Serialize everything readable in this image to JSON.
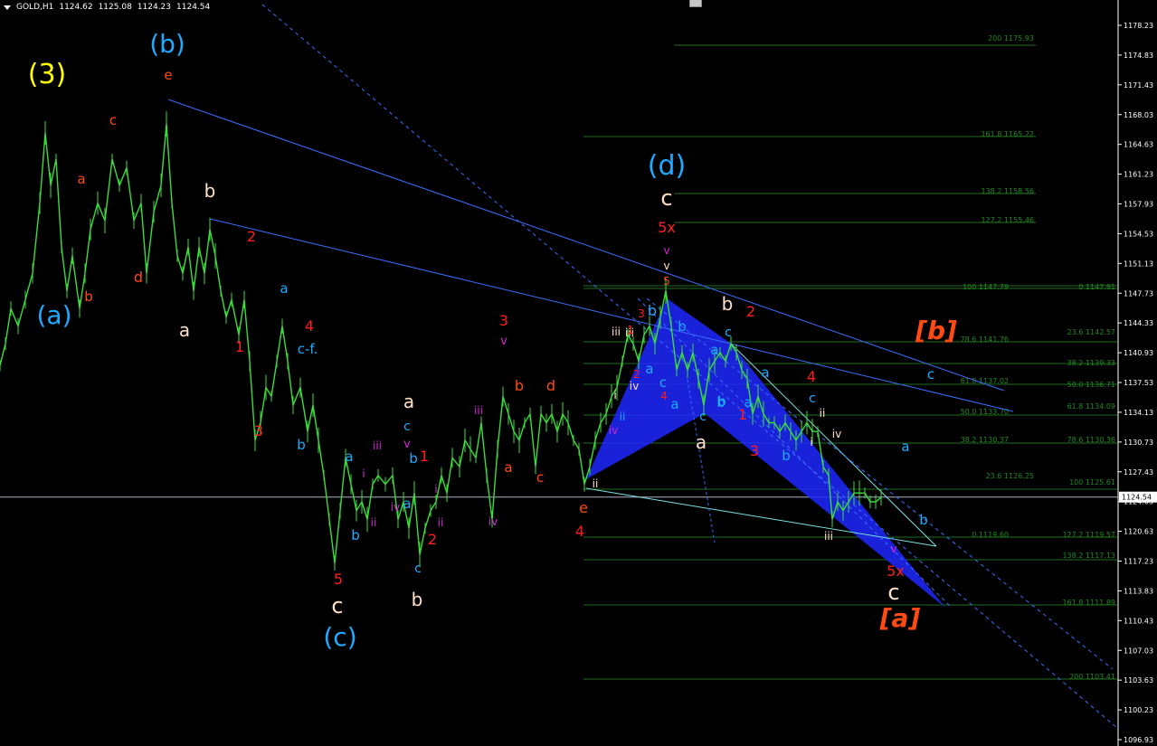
{
  "header": {
    "symbol": "GOLD,H1",
    "open": "1124.62",
    "high": "1125.08",
    "low": "1124.23",
    "close": "1124.54"
  },
  "chart_data": {
    "type": "candlestick",
    "symbol": "GOLD,H1",
    "ylim": [
      1096.93,
      1178.23
    ],
    "y_ticks": [
      "1178.23",
      "1174.83",
      "1171.43",
      "1168.03",
      "1164.63",
      "1161.23",
      "1157.93",
      "1154.53",
      "1151.13",
      "1147.73",
      "1144.33",
      "1140.93",
      "1137.53",
      "1134.13",
      "1130.73",
      "1127.43",
      "1124.03",
      "1120.63",
      "1117.23",
      "1113.83",
      "1110.43",
      "1107.03",
      "1103.63",
      "1100.23",
      "1096.93"
    ],
    "current_price": "1124.54",
    "price_series": [
      [
        0,
        1139.5
      ],
      [
        6,
        1142
      ],
      [
        12,
        1146
      ],
      [
        20,
        1144
      ],
      [
        28,
        1147
      ],
      [
        36,
        1150
      ],
      [
        44,
        1158
      ],
      [
        50,
        1166
      ],
      [
        56,
        1160
      ],
      [
        62,
        1163
      ],
      [
        68,
        1153
      ],
      [
        74,
        1148
      ],
      [
        80,
        1152
      ],
      [
        88,
        1146
      ],
      [
        94,
        1150
      ],
      [
        100,
        1155
      ],
      [
        108,
        1158
      ],
      [
        116,
        1156
      ],
      [
        124,
        1163
      ],
      [
        132,
        1160
      ],
      [
        140,
        1162
      ],
      [
        148,
        1156
      ],
      [
        156,
        1158
      ],
      [
        162,
        1150
      ],
      [
        170,
        1157
      ],
      [
        178,
        1160
      ],
      [
        184,
        1167
      ],
      [
        190,
        1158
      ],
      [
        196,
        1152
      ],
      [
        202,
        1150
      ],
      [
        208,
        1153
      ],
      [
        214,
        1148
      ],
      [
        220,
        1153
      ],
      [
        226,
        1150
      ],
      [
        232,
        1155
      ],
      [
        238,
        1152
      ],
      [
        244,
        1148
      ],
      [
        250,
        1145
      ],
      [
        256,
        1147
      ],
      [
        264,
        1143
      ],
      [
        270,
        1147
      ],
      [
        276,
        1140
      ],
      [
        282,
        1131
      ],
      [
        288,
        1133
      ],
      [
        294,
        1137
      ],
      [
        300,
        1136
      ],
      [
        306,
        1140
      ],
      [
        312,
        1144
      ],
      [
        318,
        1140
      ],
      [
        324,
        1135
      ],
      [
        332,
        1137
      ],
      [
        340,
        1132
      ],
      [
        346,
        1135
      ],
      [
        352,
        1131
      ],
      [
        358,
        1127
      ],
      [
        364,
        1122
      ],
      [
        370,
        1117
      ],
      [
        376,
        1123
      ],
      [
        382,
        1129
      ],
      [
        388,
        1126
      ],
      [
        394,
        1123
      ],
      [
        400,
        1124
      ],
      [
        406,
        1122
      ],
      [
        412,
        1126
      ],
      [
        418,
        1127
      ],
      [
        426,
        1126
      ],
      [
        434,
        1127
      ],
      [
        440,
        1122
      ],
      [
        446,
        1124
      ],
      [
        452,
        1121
      ],
      [
        458,
        1125
      ],
      [
        464,
        1118
      ],
      [
        470,
        1121
      ],
      [
        476,
        1123
      ],
      [
        482,
        1124
      ],
      [
        488,
        1127
      ],
      [
        494,
        1125
      ],
      [
        500,
        1129
      ],
      [
        508,
        1128
      ],
      [
        514,
        1131
      ],
      [
        520,
        1130
      ],
      [
        526,
        1129
      ],
      [
        532,
        1133
      ],
      [
        538,
        1127
      ],
      [
        544,
        1122
      ],
      [
        550,
        1130
      ],
      [
        556,
        1136
      ],
      [
        562,
        1134
      ],
      [
        568,
        1132
      ],
      [
        574,
        1131
      ],
      [
        580,
        1133
      ],
      [
        586,
        1134
      ],
      [
        592,
        1128
      ],
      [
        598,
        1134
      ],
      [
        604,
        1133
      ],
      [
        610,
        1134
      ],
      [
        616,
        1132
      ],
      [
        622,
        1134
      ],
      [
        628,
        1133
      ],
      [
        634,
        1131
      ],
      [
        640,
        1130
      ],
      [
        646,
        1126
      ],
      [
        652,
        1128
      ],
      [
        658,
        1131
      ],
      [
        664,
        1133
      ],
      [
        670,
        1134
      ],
      [
        676,
        1136
      ],
      [
        682,
        1137
      ],
      [
        688,
        1140
      ],
      [
        694,
        1143
      ],
      [
        700,
        1142
      ],
      [
        706,
        1140
      ],
      [
        712,
        1143
      ],
      [
        718,
        1144
      ],
      [
        724,
        1142
      ],
      [
        730,
        1145
      ],
      [
        736,
        1148
      ],
      [
        742,
        1144
      ],
      [
        748,
        1139
      ],
      [
        754,
        1141
      ],
      [
        760,
        1139
      ],
      [
        766,
        1141
      ],
      [
        772,
        1138
      ],
      [
        778,
        1135
      ],
      [
        784,
        1139
      ],
      [
        790,
        1140
      ],
      [
        796,
        1141
      ],
      [
        802,
        1140
      ],
      [
        808,
        1142
      ],
      [
        814,
        1141
      ],
      [
        820,
        1139
      ],
      [
        826,
        1138
      ],
      [
        832,
        1134
      ],
      [
        838,
        1136
      ],
      [
        844,
        1134
      ],
      [
        850,
        1133
      ],
      [
        856,
        1133
      ],
      [
        862,
        1132
      ],
      [
        868,
        1133
      ],
      [
        874,
        1132
      ],
      [
        880,
        1131
      ],
      [
        886,
        1132
      ],
      [
        892,
        1133
      ],
      [
        898,
        1132
      ],
      [
        904,
        1132
      ],
      [
        910,
        1128
      ],
      [
        916,
        1127
      ],
      [
        920,
        1122
      ],
      [
        926,
        1124
      ],
      [
        932,
        1123
      ],
      [
        938,
        1124
      ],
      [
        944,
        1125
      ],
      [
        950,
        1125
      ],
      [
        956,
        1125
      ],
      [
        962,
        1124
      ],
      [
        968,
        1124
      ],
      [
        974,
        1124.5
      ]
    ],
    "fib_levels": [
      {
        "label": "200 1175.93",
        "anchor": "left"
      },
      {
        "label": "161.8 1165.22",
        "anchor": "left"
      },
      {
        "label": "138.2 1158.56",
        "anchor": "left"
      },
      {
        "label": "127.2 1155.46",
        "anchor": "left"
      },
      {
        "label": "100 1147.79",
        "anchor": "left"
      },
      {
        "label": "0 1147.81",
        "anchor": "right"
      },
      {
        "label": "78.6 1141.76",
        "anchor": "left"
      },
      {
        "label": "23.6 1142.57",
        "anchor": "right"
      },
      {
        "label": "38.2 1139.33",
        "anchor": "right"
      },
      {
        "label": "61.8 1137.02",
        "anchor": "left"
      },
      {
        "label": "50.0 1136.71",
        "anchor": "right"
      },
      {
        "label": "50.0 1133.70",
        "anchor": "left"
      },
      {
        "label": "61.8 1134.09",
        "anchor": "right"
      },
      {
        "label": "38.2 1130.37",
        "anchor": "left"
      },
      {
        "label": "78.6 1130.36",
        "anchor": "right"
      },
      {
        "label": "23.6 1126.25",
        "anchor": "left"
      },
      {
        "label": "100 1125.61",
        "anchor": "right"
      },
      {
        "label": "0 1119.60",
        "anchor": "left"
      },
      {
        "label": "127.2 1119.57",
        "anchor": "right"
      },
      {
        "label": "138.2 1117.13",
        "anchor": "right"
      },
      {
        "label": "161.8 1111.89",
        "anchor": "right"
      },
      {
        "label": "200 1103.41",
        "anchor": "right"
      }
    ],
    "wave_labels": [
      {
        "t": "(3)",
        "c": "#ffff00",
        "s": 30
      },
      {
        "t": "(b)",
        "c": "#1eaaff",
        "s": 28
      },
      {
        "t": "e",
        "c": "#ff4a14",
        "s": 15
      },
      {
        "t": "c",
        "c": "#ff4a14",
        "s": 15
      },
      {
        "t": "a",
        "c": "#ff4a14",
        "s": 15
      },
      {
        "t": "b",
        "c": "#ffe1c8",
        "s": 20
      },
      {
        "t": "2",
        "c": "#ff1e1e",
        "s": 16
      },
      {
        "t": "b",
        "c": "#ff4a14",
        "s": 15
      },
      {
        "t": "d",
        "c": "#ff4a14",
        "s": 16
      },
      {
        "t": "(a)",
        "c": "#1eaaff",
        "s": 28
      },
      {
        "t": "a",
        "c": "#ffe1c8",
        "s": 20
      },
      {
        "t": "a",
        "c": "#1eaaff",
        "s": 15
      },
      {
        "t": "4",
        "c": "#ff1e1e",
        "s": 16
      },
      {
        "t": "c-f.",
        "c": "#1eaaff",
        "s": 15
      },
      {
        "t": "1",
        "c": "#ff1e1e",
        "s": 16
      },
      {
        "t": "3",
        "c": "#ff1e1e",
        "s": 16
      },
      {
        "t": "b",
        "c": "#1eaaff",
        "s": 15
      },
      {
        "t": "a",
        "c": "#ffe1c8",
        "s": 20
      },
      {
        "t": "c",
        "c": "#1eaaff",
        "s": 14
      },
      {
        "t": "v",
        "c": "#d228d2",
        "s": 13
      },
      {
        "t": "b",
        "c": "#1eaaff",
        "s": 15
      },
      {
        "t": "1",
        "c": "#ff1e1e",
        "s": 16
      },
      {
        "t": "a",
        "c": "#1eaaff",
        "s": 15
      },
      {
        "t": "iii",
        "c": "#d228d2",
        "s": 12
      },
      {
        "t": "i",
        "c": "#d228d2",
        "s": 12
      },
      {
        "t": "iv",
        "c": "#d228d2",
        "s": 12
      },
      {
        "t": "a",
        "c": "#1eaaff",
        "s": 15
      },
      {
        "t": "i",
        "c": "#d228d2",
        "s": 12
      },
      {
        "t": "ii",
        "c": "#d228d2",
        "s": 12
      },
      {
        "t": "b",
        "c": "#1eaaff",
        "s": 15
      },
      {
        "t": "ii",
        "c": "#d228d2",
        "s": 12
      },
      {
        "t": "2",
        "c": "#ff1e1e",
        "s": 16
      },
      {
        "t": "5",
        "c": "#ff1e1e",
        "s": 16
      },
      {
        "t": "c",
        "c": "#ffe1c8",
        "s": 24
      },
      {
        "t": "(c)",
        "c": "#1eaaff",
        "s": 28
      },
      {
        "t": "c",
        "c": "#1eaaff",
        "s": 14
      },
      {
        "t": "b",
        "c": "#ffe1c8",
        "s": 20
      },
      {
        "t": "3",
        "c": "#ff1e1e",
        "s": 16
      },
      {
        "t": "v",
        "c": "#d228d2",
        "s": 13
      },
      {
        "t": "iii",
        "c": "#d228d2",
        "s": 12
      },
      {
        "t": "b",
        "c": "#ff4a14",
        "s": 16
      },
      {
        "t": "d",
        "c": "#ff4a14",
        "s": 16
      },
      {
        "t": "a",
        "c": "#ff4a14",
        "s": 15
      },
      {
        "t": "c",
        "c": "#ff4a14",
        "s": 15
      },
      {
        "t": "iv",
        "c": "#d228d2",
        "s": 12
      },
      {
        "t": "e",
        "c": "#ff4a14",
        "s": 16
      },
      {
        "t": "4",
        "c": "#ff1e1e",
        "s": 16
      },
      {
        "t": "iii",
        "c": "#ffe1c8",
        "s": 12
      },
      {
        "t": "i",
        "c": "#ffe1c8",
        "s": 12
      },
      {
        "t": "ii",
        "c": "#ffe1c8",
        "s": 12
      },
      {
        "t": "(d)",
        "c": "#1eaaff",
        "s": 30
      },
      {
        "t": "c",
        "c": "#ffe1c8",
        "s": 24
      },
      {
        "t": "5x",
        "c": "#ff1e1e",
        "s": 16
      },
      {
        "t": "v",
        "c": "#d228d2",
        "s": 12
      },
      {
        "t": "v",
        "c": "#ffe1c8",
        "s": 12
      },
      {
        "t": "5",
        "c": "#ff4a14",
        "s": 12
      },
      {
        "t": "3",
        "c": "#ff1e1e",
        "s": 12
      },
      {
        "t": "iii",
        "c": "#ffe1c8",
        "s": 12
      },
      {
        "t": "1",
        "c": "#ff1e1e",
        "s": 12
      },
      {
        "t": "b",
        "c": "#1eaaff",
        "s": 16
      },
      {
        "t": "a",
        "c": "#1eaaff",
        "s": 15
      },
      {
        "t": "b",
        "c": "#1eaaff",
        "s": 15
      },
      {
        "t": "2",
        "c": "#ff1e1e",
        "s": 12
      },
      {
        "t": "iv",
        "c": "#ffe1c8",
        "s": 12
      },
      {
        "t": "i",
        "c": "#ffe1c8",
        "s": 12
      },
      {
        "t": "ii",
        "c": "#1eaaff",
        "s": 12
      },
      {
        "t": "iv",
        "c": "#d228d2",
        "s": 12
      },
      {
        "t": "c",
        "c": "#1eaaff",
        "s": 15
      },
      {
        "t": "4",
        "c": "#ff1e1e",
        "s": 12
      },
      {
        "t": "a",
        "c": "#1eaaff",
        "s": 15
      },
      {
        "t": "b",
        "c": "#1eaaff",
        "s": 15
      },
      {
        "t": "c",
        "c": "#1eaaff",
        "s": 14
      },
      {
        "t": "a",
        "c": "#ffe1c8",
        "s": 20
      },
      {
        "t": "b",
        "c": "#ffe1c8",
        "s": 20
      },
      {
        "t": "c",
        "c": "#1eaaff",
        "s": 14
      },
      {
        "t": "2",
        "c": "#ff1e1e",
        "s": 16
      },
      {
        "t": "a",
        "c": "#1eaaff",
        "s": 15
      },
      {
        "t": "a",
        "c": "#1eaaff",
        "s": 15
      },
      {
        "t": "b",
        "c": "#1eaaff",
        "s": 15
      },
      {
        "t": "1",
        "c": "#ff1e1e",
        "s": 16
      },
      {
        "t": "4",
        "c": "#ff1e1e",
        "s": 16
      },
      {
        "t": "c",
        "c": "#1eaaff",
        "s": 14
      },
      {
        "t": "a",
        "c": "#1eaaff",
        "s": 15
      },
      {
        "t": "3",
        "c": "#ff1e1e",
        "s": 16
      },
      {
        "t": "b",
        "c": "#1eaaff",
        "s": 15
      },
      {
        "t": "ii",
        "c": "#ffe1c8",
        "s": 12
      },
      {
        "t": "iv",
        "c": "#ffe1c8",
        "s": 12
      },
      {
        "t": "i",
        "c": "#ffe1c8",
        "s": 12
      },
      {
        "t": "iii",
        "c": "#ffe1c8",
        "s": 12
      },
      {
        "t": "v",
        "c": "#d228d2",
        "s": 12
      },
      {
        "t": "5x",
        "c": "#ff1e1e",
        "s": 16
      },
      {
        "t": "c",
        "c": "#ffe1c8",
        "s": 24
      },
      {
        "t": "[b]",
        "c": "#ff4a14",
        "s": 28
      },
      {
        "t": "[a]",
        "c": "#ff4a14",
        "s": 28
      },
      {
        "t": "c",
        "c": "#1eaaff",
        "s": 15
      },
      {
        "t": "a",
        "c": "#1eaaff",
        "s": 15
      },
      {
        "t": "b",
        "c": "#1eaaff",
        "s": 15
      }
    ]
  }
}
